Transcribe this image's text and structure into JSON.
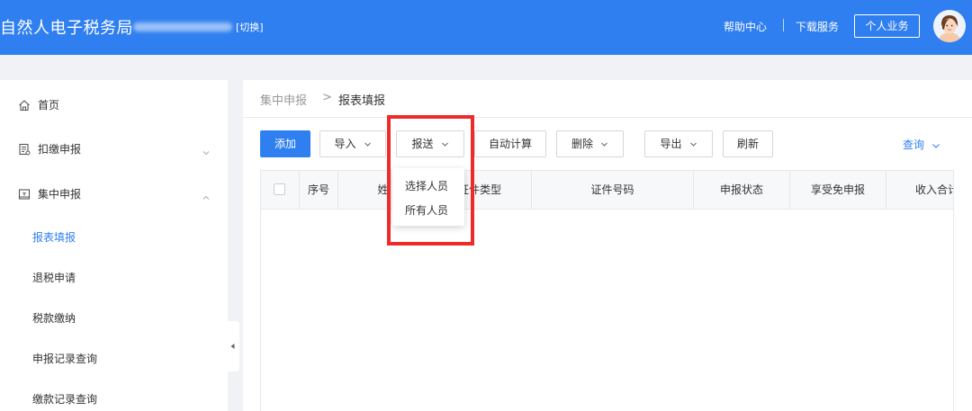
{
  "header": {
    "app_title": "自然人电子税务局",
    "switch_label": "[切换]",
    "help_center": "帮助中心",
    "download_service": "下载服务",
    "personal_business": "个人业务",
    "accent_color": "#2f7ff0"
  },
  "sidebar": {
    "home": "首页",
    "withholding": "扣缴申报",
    "centralized": "集中申报",
    "sub_items": [
      "报表填报",
      "退税申请",
      "税款缴纳",
      "申报记录查询",
      "缴款记录查询"
    ],
    "active_sub_item": "报表填报",
    "withholding_chevron": "chevron-down-icon",
    "centralized_chevron": "chevron-up-icon"
  },
  "breadcrumb": {
    "parent": "集中申报",
    "separator": ">",
    "current": "报表填报"
  },
  "toolbar": {
    "add": "添加",
    "import": "导入",
    "submit": "报送",
    "auto_calc": "自动计算",
    "delete": "删除",
    "export": "导出",
    "refresh": "刷新",
    "query": "查询"
  },
  "table": {
    "columns": [
      "序号",
      "姓",
      "证件类型",
      "证件号码",
      "申报状态",
      "享受免申报",
      "收入合计"
    ],
    "rows": []
  },
  "dropdown": {
    "items": [
      "选择人员",
      "所有人员"
    ]
  },
  "annotation": {
    "highlight_color": "#ee2b2b"
  }
}
